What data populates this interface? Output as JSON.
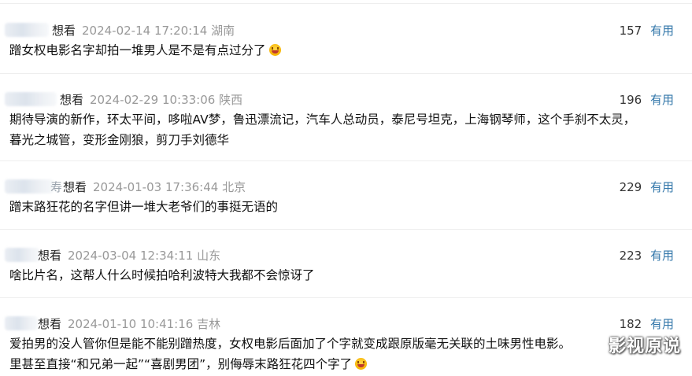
{
  "reviews": [
    {
      "username": "想看",
      "time": "2024-02-14 17:20:14 湖南",
      "votes": "157",
      "vote_label": "有用",
      "content": "蹭女权电影名字却拍一堆男人是不是有点过分了"
    },
    {
      "username": "想看",
      "time": "2024-02-29 10:33:06 陕西",
      "votes": "196",
      "vote_label": "有用",
      "content_line1": "期待导演的新作，环太平间，哆啦AV梦，鲁迅漂流记，汽车人总动员，泰尼号坦克，上海钢琴师，这个手刹不太灵，",
      "content_line2": "暮光之城管，变形金刚狼，剪刀手刘德华"
    },
    {
      "username": "想看",
      "username_prefix": "寿",
      "time": "2024-01-03 17:36:44 北京",
      "votes": "229",
      "vote_label": "有用",
      "content": "蹭末路狂花的名字但讲一堆大老爷们的事挺无语的"
    },
    {
      "username": "想看",
      "time": "2024-03-04 12:34:11 山东",
      "votes": "223",
      "vote_label": "有用",
      "content": "啥比片名，这帮人什么时候拍哈利波特大我都不会惊讶了"
    },
    {
      "username": "想看",
      "time": "2024-01-10 10:41:16 吉林",
      "votes": "182",
      "vote_label": "有用",
      "content_line1": "爱拍男的没人管你但是能不能别蹭热度，女权电影后面加了个字就变成跟原版毫无关联的土味男性电影。",
      "content_line2": "里甚至直接“和兄弟一起”“喜剧男团”，别侮辱末路狂花四个字了"
    }
  ],
  "watermark": "影视原说",
  "emoji_name": "grinning-face-icon"
}
